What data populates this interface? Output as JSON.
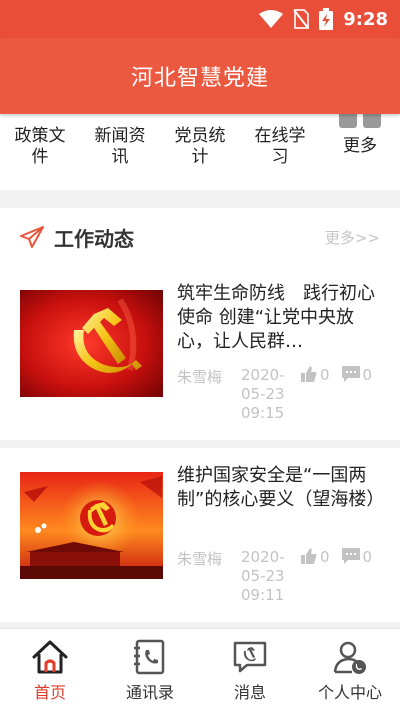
{
  "status_bar": {
    "time": "9:28"
  },
  "header": {
    "title": "河北智慧党建"
  },
  "quick_menu": {
    "items": [
      {
        "label": "政策文件"
      },
      {
        "label": "新闻资讯"
      },
      {
        "label": "党员统计"
      },
      {
        "label": "在线学习"
      },
      {
        "label": "更多"
      }
    ]
  },
  "section": {
    "title": "工作动态",
    "more": "更多>>"
  },
  "news": [
    {
      "title": "筑牢生命防线　践行初心使命 创建“让党中央放心，让人民群…",
      "author": "朱雪梅",
      "date": "2020-05-23 09:15",
      "likes": "0",
      "comments": "0"
    },
    {
      "title": "维护国家安全是“一国两制”的核心要义（望海楼）",
      "author": "朱雪梅",
      "date": "2020-05-23 09:11",
      "likes": "0",
      "comments": "0"
    }
  ],
  "bottom_nav": {
    "items": [
      {
        "label": "首页"
      },
      {
        "label": "通讯录"
      },
      {
        "label": "消息"
      },
      {
        "label": "个人中心"
      }
    ]
  },
  "colors": {
    "brand": "#eb5a40",
    "active": "#e53c2a",
    "muted": "#c3c3c3"
  }
}
